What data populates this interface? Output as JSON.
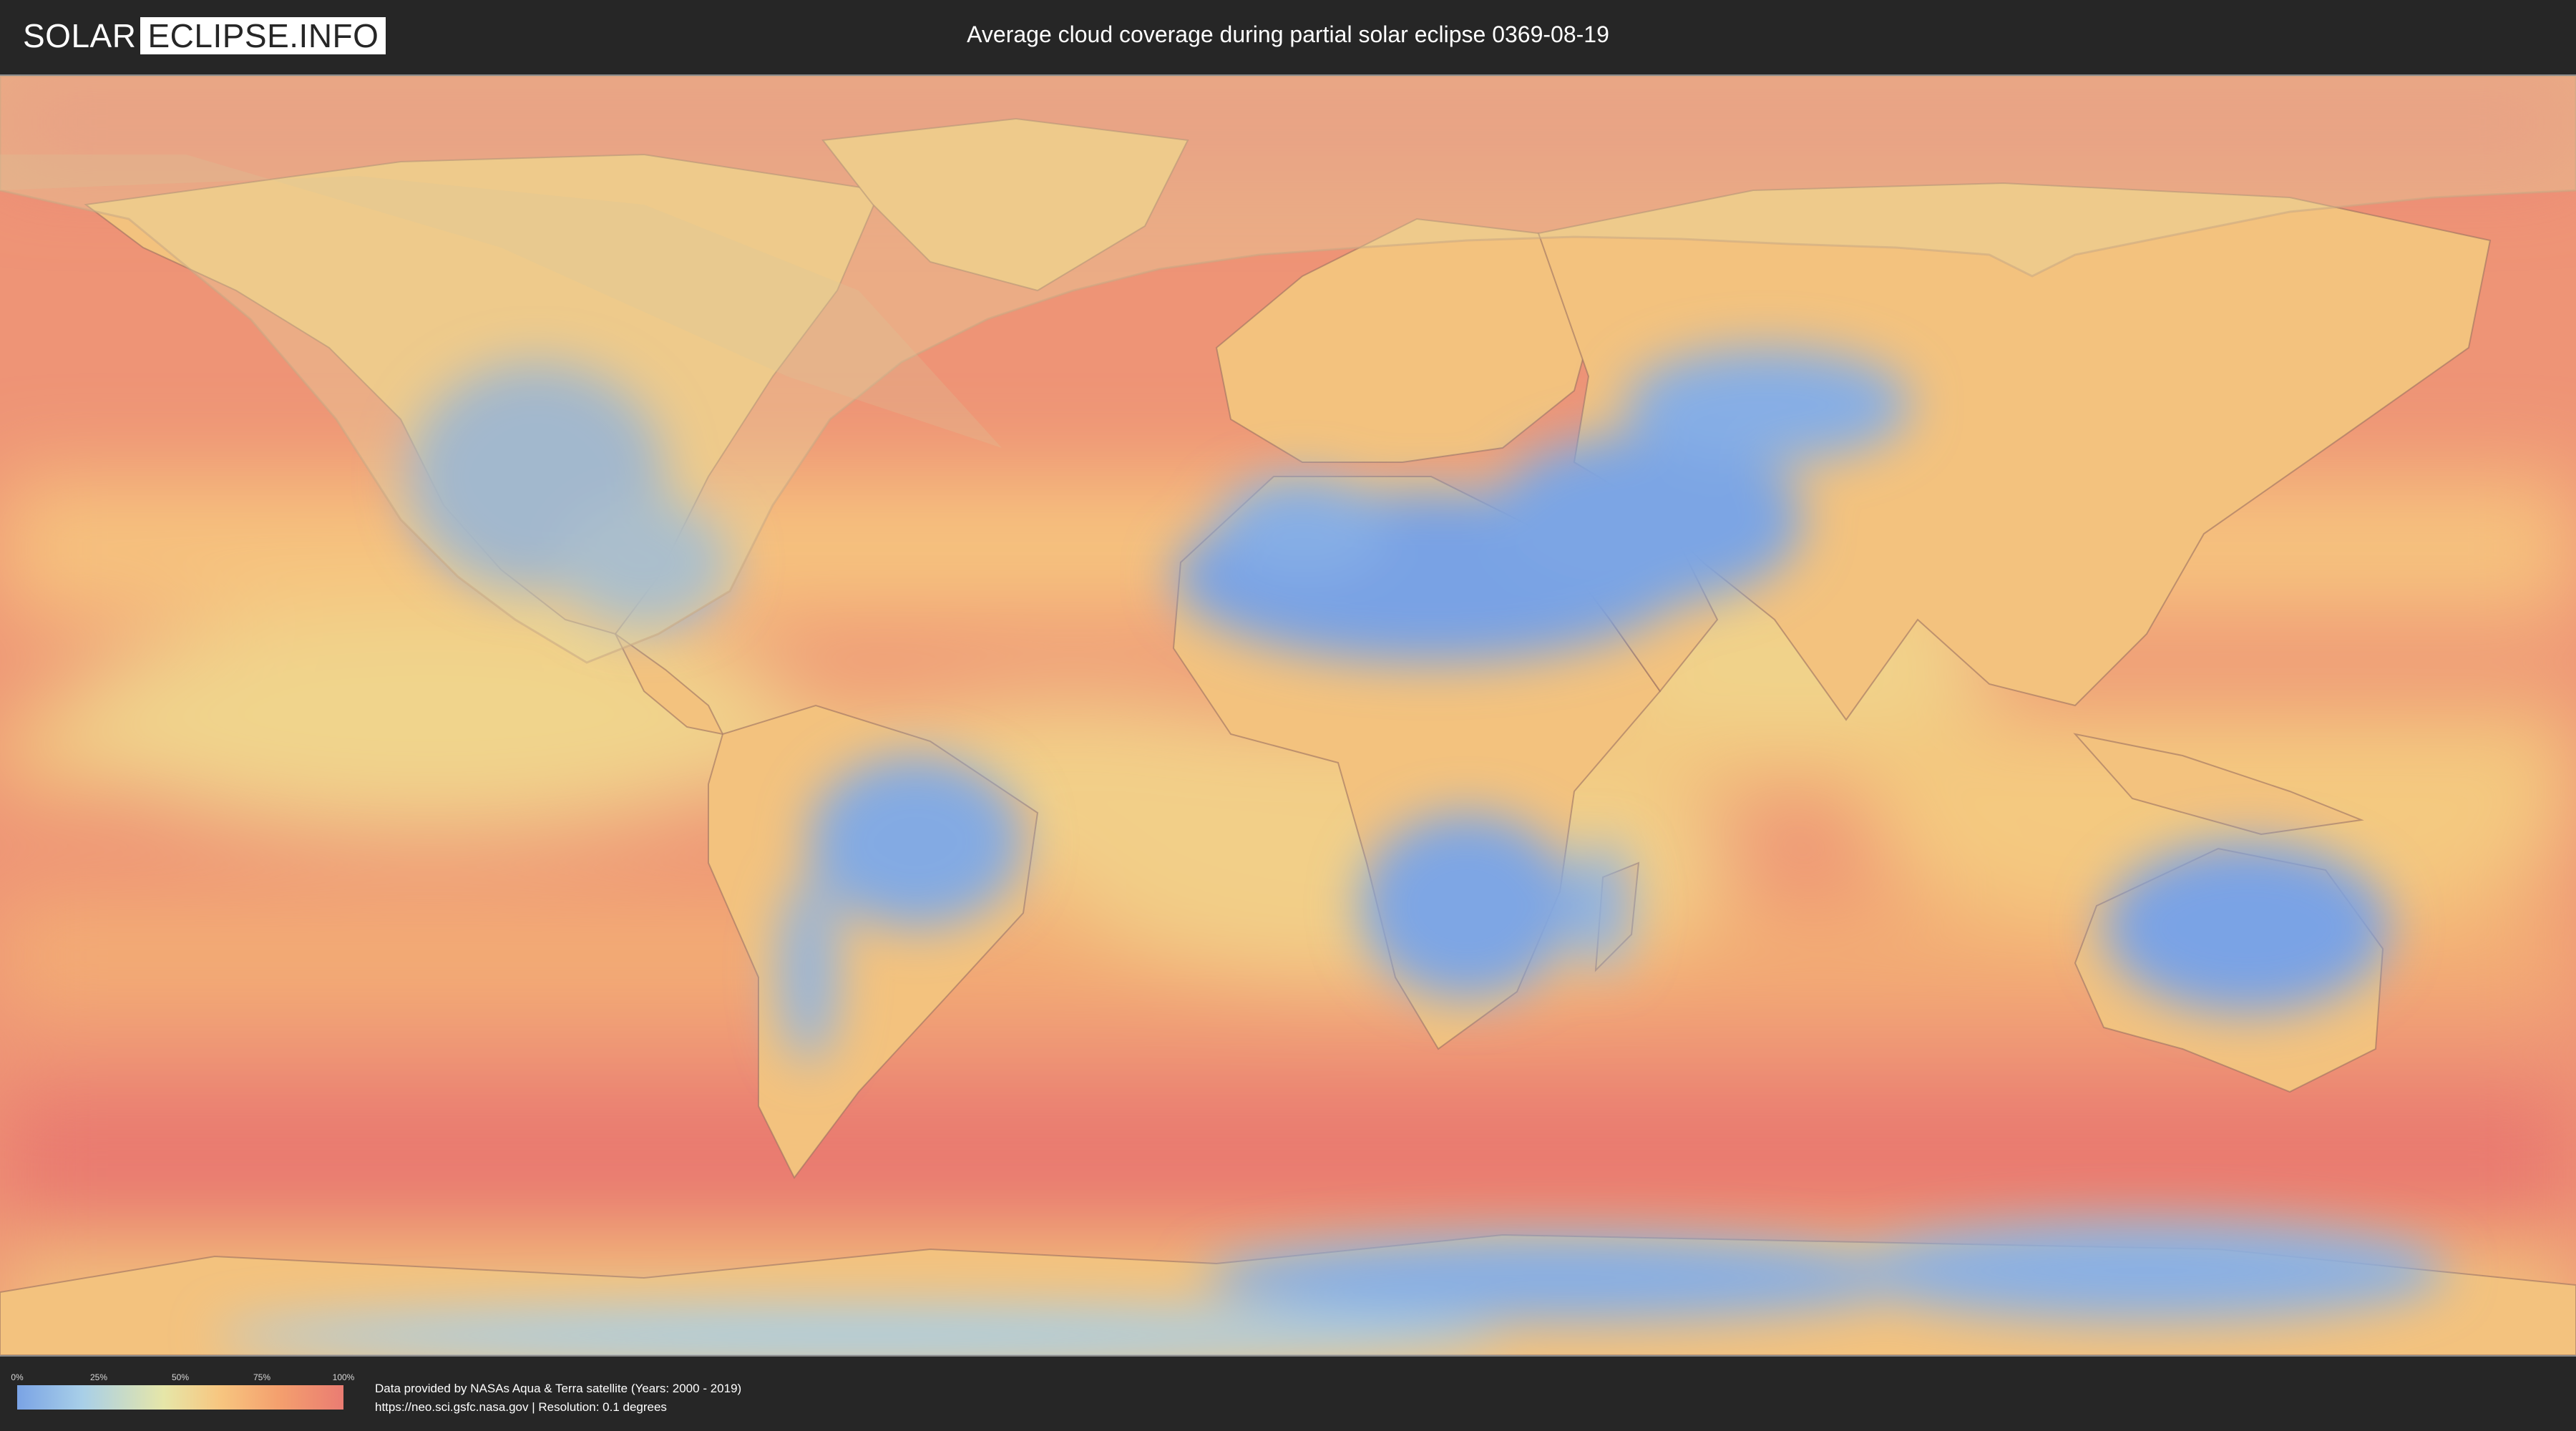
{
  "header": {
    "logo_left": "SOLAR",
    "logo_right": "ECLIPSE.INFO",
    "title": "Average cloud coverage during partial solar eclipse 0369-08-19"
  },
  "map": {
    "colors": {
      "ocean_cloudy": "#ea7c72",
      "ocean_mid": "#f4a06e",
      "cloud_med": "#f7c680",
      "cloud_low": "#e6e6a8",
      "clear_sky": "#7aa3e5",
      "clear_light": "#a8cfe8",
      "eclipse_overlay": "#d8c890",
      "coastline": "#8a6a58"
    }
  },
  "legend": {
    "ticks": [
      {
        "label": "0%",
        "value": 0
      },
      {
        "label": "25%",
        "value": 0.25
      },
      {
        "label": "50%",
        "value": 0.5
      },
      {
        "label": "75%",
        "value": 0.75
      },
      {
        "label": "100%",
        "value": 1
      }
    ],
    "gradient_colors": [
      "#7aa3e5",
      "#a8cfe8",
      "#e6e6a8",
      "#f7c680",
      "#f4a06e",
      "#ea7c72"
    ]
  },
  "credits": {
    "line1": "Data provided by NASAs Aqua & Terra satellite (Years: 2000 - 2019)",
    "line2": "https://neo.sci.gsfc.nasa.gov | Resolution: 0.1 degrees"
  }
}
